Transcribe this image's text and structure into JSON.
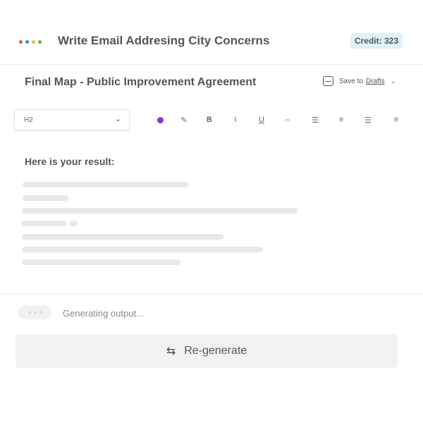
{
  "header": {
    "title": "Write Email Addresing City Concerns",
    "credit": "Credit: 323",
    "dot_colors": [
      "#e8533f",
      "#3d7ff0",
      "#f0b73d",
      "#3fbf6a"
    ]
  },
  "document": {
    "title": "Final Map - Public Improvement Agreement",
    "save_prefix": "Save to",
    "save_link": "Drafts",
    "caret": "⌄"
  },
  "editor": {
    "heading_select": "H2",
    "select_caret": "⌄",
    "tools": [
      {
        "name": "color-icon",
        "glyph": ""
      },
      {
        "name": "highlight-icon",
        "glyph": "✎"
      },
      {
        "name": "bold-icon",
        "glyph": "B"
      },
      {
        "name": "italic-icon",
        "glyph": "I"
      },
      {
        "name": "underline-icon",
        "glyph": "U"
      },
      {
        "name": "link-icon",
        "glyph": "⇔"
      },
      {
        "name": "list-icon",
        "glyph": "☰"
      },
      {
        "name": "align-left-icon",
        "glyph": "≡"
      },
      {
        "name": "align-center-icon",
        "glyph": "☰"
      },
      {
        "name": "align-right-icon",
        "glyph": "≡"
      }
    ],
    "accent_color": "#8e33d6"
  },
  "result": {
    "label": "Here is your result:"
  },
  "status": {
    "generating_text": "Generating output..."
  },
  "actions": {
    "regenerate_label": "Re-generate",
    "regenerate_icon": "⇆"
  }
}
